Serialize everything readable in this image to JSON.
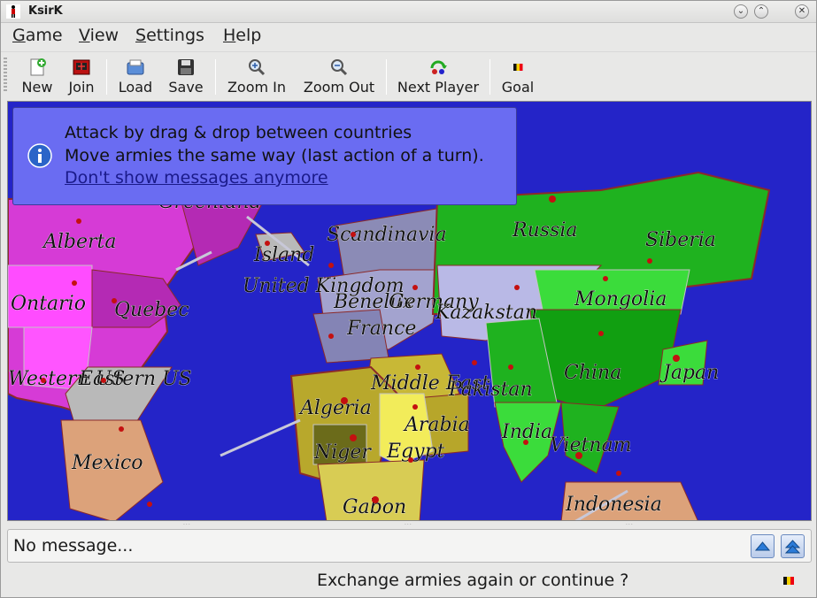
{
  "window": {
    "title": "KsirK"
  },
  "menu": [
    {
      "key": "G",
      "rest": "ame"
    },
    {
      "key": "V",
      "rest": "iew"
    },
    {
      "key": "S",
      "rest": "ettings"
    },
    {
      "key": "H",
      "rest": "elp"
    }
  ],
  "toolbar": {
    "new": "New",
    "join": "Join",
    "load": "Load",
    "save": "Save",
    "zoom_in": "Zoom In",
    "zoom_out": "Zoom Out",
    "next_player": "Next Player",
    "goal": "Goal"
  },
  "info": {
    "line1": "Attack by drag & drop between countries",
    "line2": "Move armies the same way (last action of a turn).",
    "link": "Don't show messages anymore"
  },
  "map": {
    "ocean": "#2424c8",
    "labels": [
      "Alberta",
      "Greenland",
      "Island",
      "Scandinavia",
      "Russia",
      "Siberia",
      "Ontario",
      "Quebec",
      "United Kingdom",
      "Benelux",
      "Germany",
      "Kazakstan",
      "Mongolia",
      "France",
      "Western US",
      "Eastern US",
      "Middle East",
      "China",
      "Japan",
      "Algeria",
      "Pakistan",
      "Arabia",
      "India",
      "Vietnam",
      "Niger",
      "Egypt",
      "Mexico",
      "Gabon",
      "Indonesia"
    ]
  },
  "messages": {
    "current": "No message..."
  },
  "status": {
    "text": "Exchange armies again or continue ?"
  }
}
